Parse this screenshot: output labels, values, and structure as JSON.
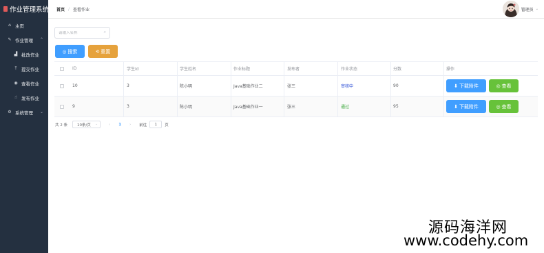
{
  "app": {
    "title": "作业管理系统"
  },
  "sidebar": {
    "items": [
      {
        "label": "主页",
        "icon": "home-icon"
      },
      {
        "label": "作业管理",
        "icon": "edit-icon",
        "expanded": true
      },
      {
        "label": "批改作业",
        "icon": "chart-icon"
      },
      {
        "label": "提交作业",
        "icon": "upload-icon"
      },
      {
        "label": "查看作业",
        "icon": "eye-icon"
      },
      {
        "label": "发布作业",
        "icon": "thumb-icon"
      },
      {
        "label": "系统管理",
        "icon": "gear-icon",
        "expanded": false
      }
    ]
  },
  "breadcrumb": {
    "home": "首页",
    "current": "查看作业"
  },
  "user": {
    "name": "管理员"
  },
  "search": {
    "placeholder": "请输入名称"
  },
  "buttons": {
    "search": "搜索",
    "reset": "重置"
  },
  "table": {
    "headers": [
      "ID",
      "学生id",
      "学生姓名",
      "作业标题",
      "发布者",
      "作业状态",
      "分数",
      "操作"
    ],
    "rows": [
      {
        "id": "10",
        "student_id": "3",
        "student_name": "陈小明",
        "title": "Java基础作业二",
        "publisher": "张三",
        "status": "审核中",
        "score": "90"
      },
      {
        "id": "9",
        "student_id": "3",
        "student_name": "陈小明",
        "title": "Java基础作业一",
        "publisher": "张三",
        "status": "通过",
        "score": "95"
      }
    ],
    "actions": {
      "download": "下载附件",
      "view": "查看"
    }
  },
  "pagination": {
    "total": "共 2 条",
    "page_size": "10条/页",
    "prev": "‹",
    "current_page": "1",
    "next": "›",
    "goto_label": "前往",
    "goto_value": "1",
    "goto_unit": "页"
  },
  "watermark": {
    "cn": "源码海洋网",
    "url": "www.codehy.com"
  },
  "colors": {
    "sidebar": "#243040",
    "primary": "#409eff",
    "warning": "#e6a23c",
    "success": "#67c23a"
  }
}
